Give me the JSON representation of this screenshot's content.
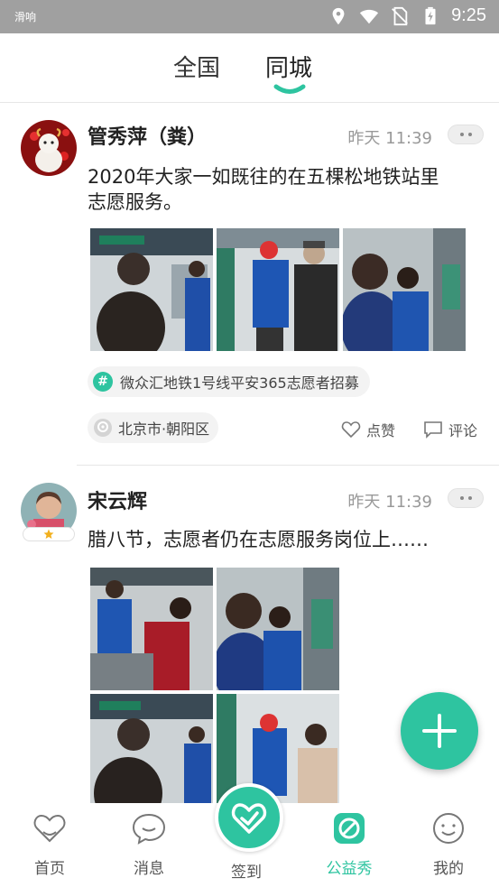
{
  "status_bar": {
    "carrier": "滑响",
    "time": "9:25"
  },
  "tabs": [
    {
      "label": "全国",
      "active": false
    },
    {
      "label": "同城",
      "active": true
    }
  ],
  "posts": [
    {
      "author": "管秀萍（粪）",
      "time": "昨天 11:39",
      "text_lines": [
        "2020年大家一如既往的在五棵松地铁站里",
        "志愿服务。"
      ],
      "topic": "微众汇地铁1号线平安365志愿者招募",
      "location": "北京市·朝阳区",
      "like_label": "点赞",
      "comment_label": "评论",
      "photo_count": 3
    },
    {
      "author": "宋云辉",
      "time": "昨天 11:39",
      "text_lines": [
        "腊八节，志愿者仍在志愿服务岗位上……"
      ],
      "photo_count": 4
    }
  ],
  "bottom_nav": [
    {
      "label": "首页",
      "icon": "heart-outline-icon",
      "active": false
    },
    {
      "label": "消息",
      "icon": "chat-bubble-icon",
      "active": false
    },
    {
      "label": "签到",
      "icon": "heart-hand-icon",
      "active": false
    },
    {
      "label": "公益秀",
      "icon": "camera-ring-icon",
      "active": true
    },
    {
      "label": "我的",
      "icon": "smiley-face-icon",
      "active": false
    }
  ],
  "colors": {
    "accent": "#2ec4a0",
    "statusbar": "#a0a0a0",
    "text": "#222222",
    "muted": "#999999"
  }
}
